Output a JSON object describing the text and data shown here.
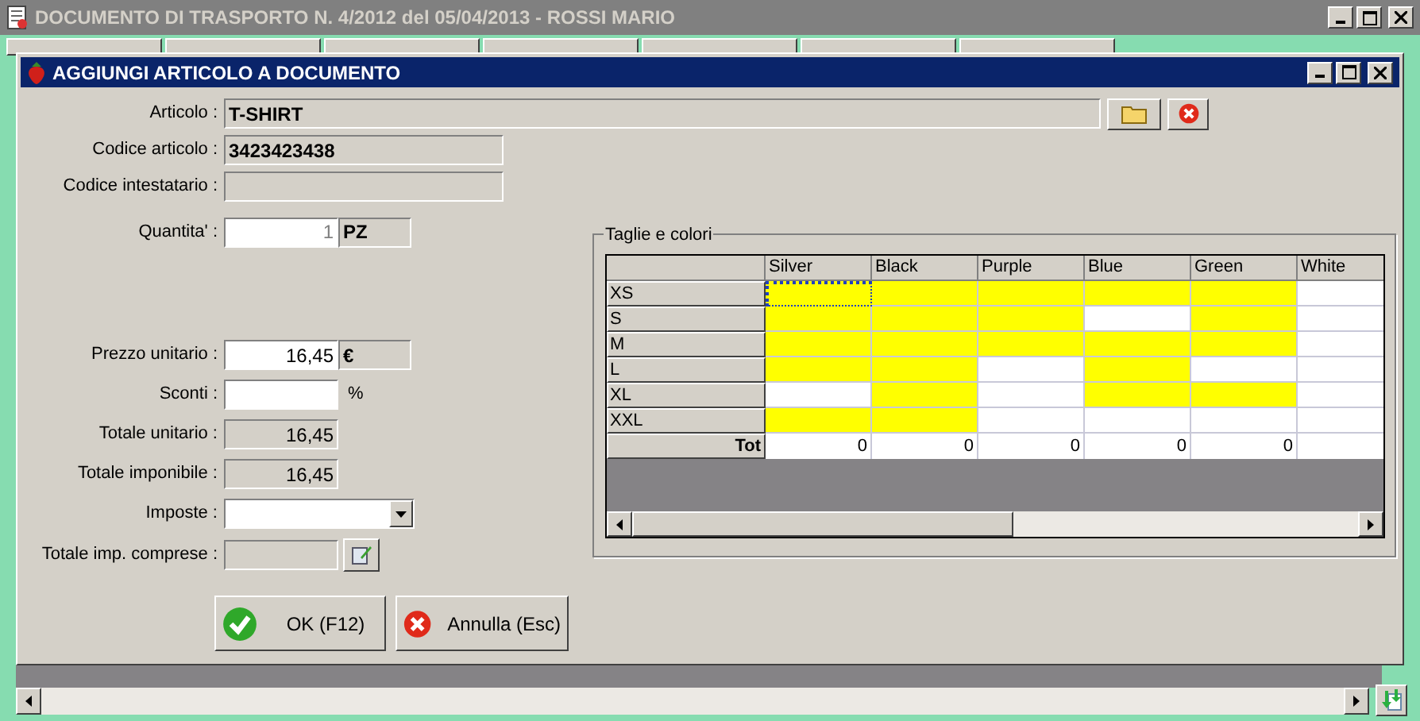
{
  "window": {
    "title": "DOCUMENTO DI TRASPORTO N. 4/2012 del 05/04/2013 - ROSSI MARIO"
  },
  "dialog": {
    "title": "AGGIUNGI ARTICOLO A DOCUMENTO"
  },
  "articolo": {
    "label": "Articolo :",
    "value": "T-SHIRT"
  },
  "codice_articolo": {
    "label": "Codice articolo :",
    "value": "3423423438"
  },
  "codice_intestatario": {
    "label": "Codice intestatario :"
  },
  "quantita": {
    "label": "Quantita' :",
    "value": "1",
    "unit": "PZ"
  },
  "prezzo_unitario": {
    "label": "Prezzo unitario :",
    "value": "16,45",
    "unit": "€"
  },
  "sconti": {
    "label": "Sconti :",
    "suffix": "%"
  },
  "totale_unitario": {
    "label": "Totale unitario :",
    "value": "16,45"
  },
  "totale_imponibile": {
    "label": "Totale imponibile :",
    "value": "16,45"
  },
  "imposte": {
    "label": "Imposte :"
  },
  "totale_imp_comprese": {
    "label": "Totale imp. comprese :"
  },
  "buttons": [
    {
      "kind": "ok",
      "label": "OK (F12)"
    },
    {
      "kind": "cancel",
      "label": "Annulla (Esc)"
    }
  ],
  "sizes_colors": {
    "title": "Taglie e colori",
    "columns": [
      "Silver",
      "Black",
      "Purple",
      "Blue",
      "Green",
      "White"
    ],
    "rows": [
      {
        "label": "XS",
        "cells": [
          {
            "highlighted": true,
            "focused": true
          },
          {
            "highlighted": true,
            "focused": false
          },
          {
            "highlighted": true,
            "focused": false
          },
          {
            "highlighted": true,
            "focused": false
          },
          {
            "highlighted": true,
            "focused": false
          },
          {
            "highlighted": false,
            "focused": false
          }
        ]
      },
      {
        "label": "S",
        "cells": [
          {
            "highlighted": true,
            "focused": false
          },
          {
            "highlighted": true,
            "focused": false
          },
          {
            "highlighted": true,
            "focused": false
          },
          {
            "highlighted": false,
            "focused": false
          },
          {
            "highlighted": true,
            "focused": false
          },
          {
            "highlighted": false,
            "focused": false
          }
        ]
      },
      {
        "label": "M",
        "cells": [
          {
            "highlighted": true,
            "focused": false
          },
          {
            "highlighted": true,
            "focused": false
          },
          {
            "highlighted": true,
            "focused": false
          },
          {
            "highlighted": true,
            "focused": false
          },
          {
            "highlighted": true,
            "focused": false
          },
          {
            "highlighted": false,
            "focused": false
          }
        ]
      },
      {
        "label": "L",
        "cells": [
          {
            "highlighted": true,
            "focused": false
          },
          {
            "highlighted": true,
            "focused": false
          },
          {
            "highlighted": false,
            "focused": false
          },
          {
            "highlighted": true,
            "focused": false
          },
          {
            "highlighted": false,
            "focused": false
          },
          {
            "highlighted": false,
            "focused": false
          }
        ]
      },
      {
        "label": "XL",
        "cells": [
          {
            "highlighted": false,
            "focused": false
          },
          {
            "highlighted": true,
            "focused": false
          },
          {
            "highlighted": false,
            "focused": false
          },
          {
            "highlighted": true,
            "focused": false
          },
          {
            "highlighted": true,
            "focused": false
          },
          {
            "highlighted": false,
            "focused": false
          }
        ]
      },
      {
        "label": "XXL",
        "cells": [
          {
            "highlighted": true,
            "focused": false
          },
          {
            "highlighted": true,
            "focused": false
          },
          {
            "highlighted": false,
            "focused": false
          },
          {
            "highlighted": false,
            "focused": false
          },
          {
            "highlighted": false,
            "focused": false
          },
          {
            "highlighted": false,
            "focused": false
          }
        ]
      }
    ],
    "total": {
      "label": "Tot",
      "values": [
        "0",
        "0",
        "0",
        "0",
        "0"
      ]
    }
  }
}
